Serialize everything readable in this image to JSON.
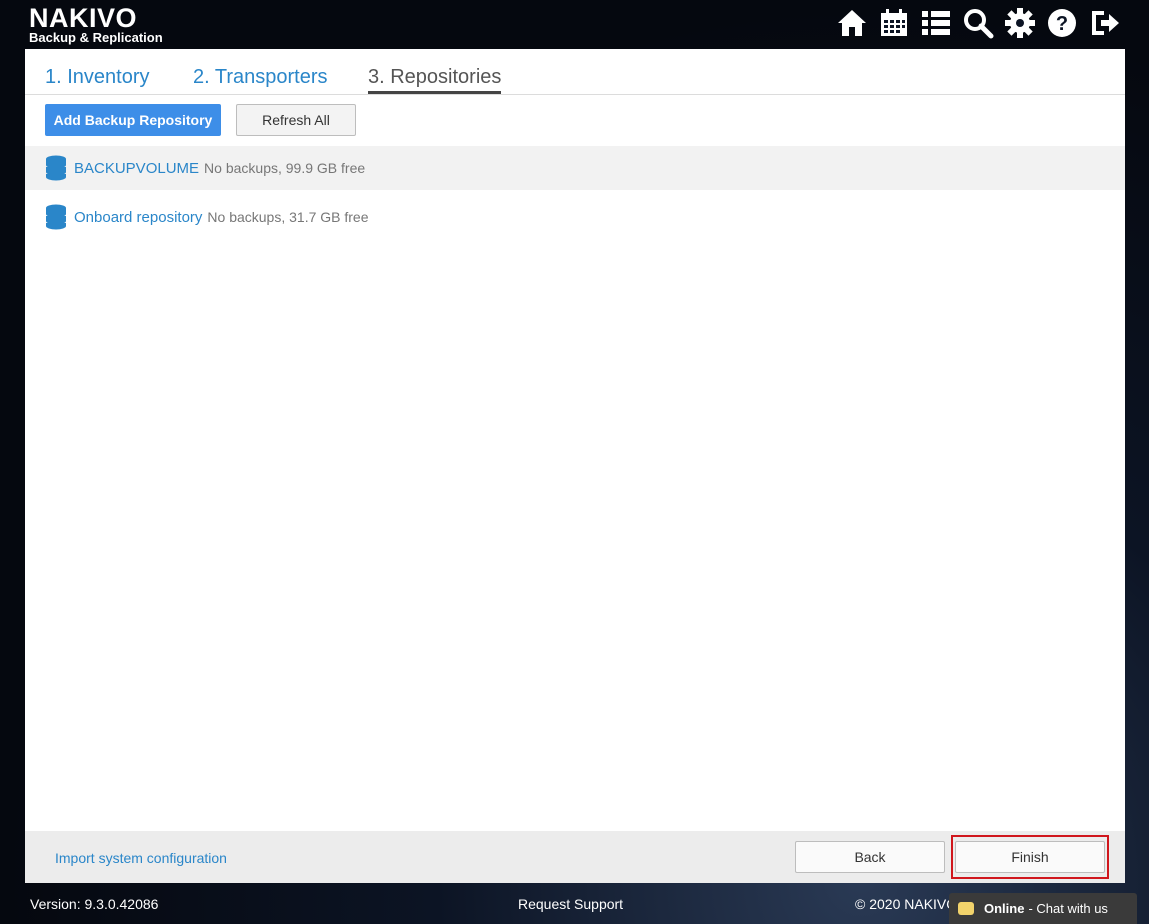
{
  "brand": {
    "name": "NAKIVO",
    "tagline": "Backup & Replication"
  },
  "toolbar_icons": [
    "home-icon",
    "calendar-icon",
    "list-icon",
    "search-icon",
    "gear-icon",
    "help-icon",
    "logout-icon"
  ],
  "tabs": [
    {
      "label": "1. Inventory",
      "active": false
    },
    {
      "label": "2. Transporters",
      "active": false
    },
    {
      "label": "3. Repositories",
      "active": true
    }
  ],
  "actions": {
    "add_label": "Add Backup Repository",
    "refresh_label": "Refresh All"
  },
  "repositories": [
    {
      "name": "BACKUPVOLUME",
      "info": "No backups, 99.9 GB free"
    },
    {
      "name": "Onboard repository",
      "info": "No backups, 31.7 GB free"
    }
  ],
  "footer": {
    "import_label": "Import system configuration",
    "back_label": "Back",
    "finish_label": "Finish"
  },
  "status": {
    "version": "Version: 9.3.0.42086",
    "support": "Request Support",
    "copyright": "© 2020 NAKIVO",
    "chat_status": "Online",
    "chat_label": "- Chat with us"
  },
  "colors": {
    "accent": "#3d8ee8",
    "link": "#2a86c9",
    "highlight": "#d0161c"
  }
}
